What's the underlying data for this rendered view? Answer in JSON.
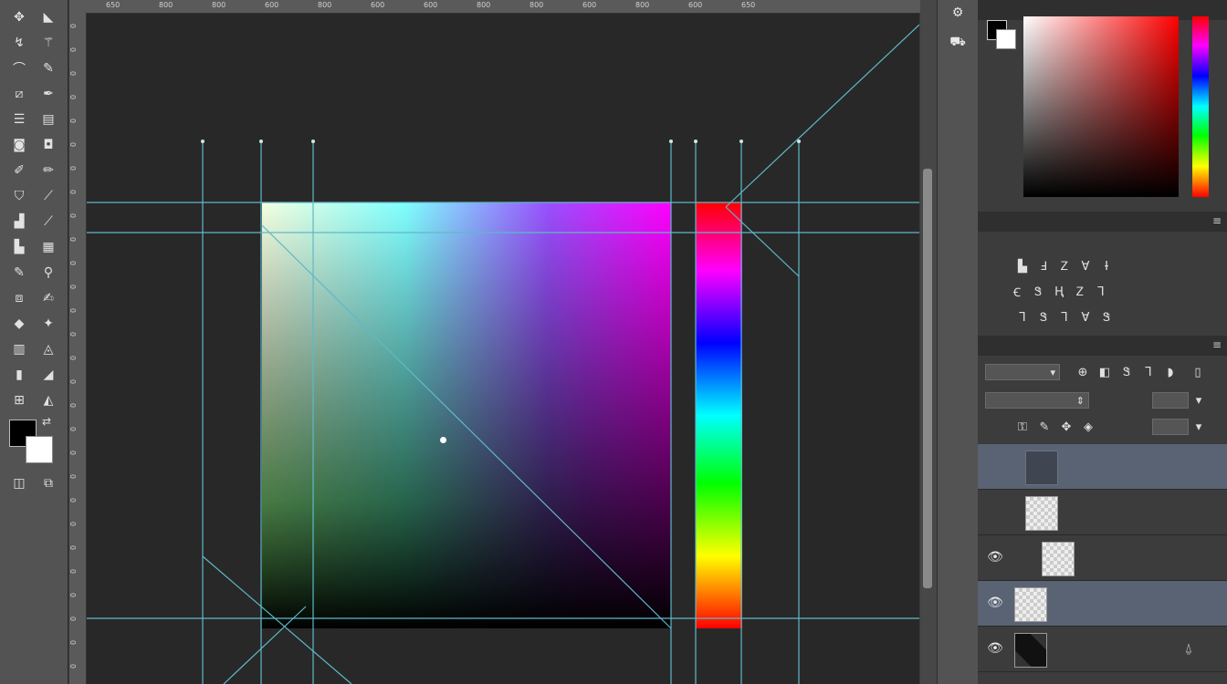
{
  "toolbar": {
    "tools": [
      {
        "icon": "move-icon",
        "glyph": "✥"
      },
      {
        "icon": "artboard-icon",
        "glyph": "◣"
      },
      {
        "icon": "lasso-icon",
        "glyph": "↯"
      },
      {
        "icon": "magic-wand-icon",
        "glyph": "⚚"
      },
      {
        "icon": "polygon-lasso-icon",
        "glyph": "⌒"
      },
      {
        "icon": "quick-select-icon",
        "glyph": "✎"
      },
      {
        "icon": "crop-icon",
        "glyph": "⧄"
      },
      {
        "icon": "eyedropper-icon",
        "glyph": "✒"
      },
      {
        "icon": "frame-icon",
        "glyph": "☰"
      },
      {
        "icon": "slice-icon",
        "glyph": "▤"
      },
      {
        "icon": "healing-brush-icon",
        "glyph": "◙"
      },
      {
        "icon": "patch-icon",
        "glyph": "◘"
      },
      {
        "icon": "brush-icon",
        "glyph": "✐"
      },
      {
        "icon": "pencil-icon",
        "glyph": "✏"
      },
      {
        "icon": "clone-stamp-icon",
        "glyph": "⛉"
      },
      {
        "icon": "history-brush-icon",
        "glyph": "⟋"
      },
      {
        "icon": "eraser-icon",
        "glyph": "▟"
      },
      {
        "icon": "bg-eraser-icon",
        "glyph": "⟋"
      },
      {
        "icon": "gradient-icon",
        "glyph": "▙"
      },
      {
        "icon": "paint-bucket-icon",
        "glyph": "▦"
      },
      {
        "icon": "blur-icon",
        "glyph": "✎"
      },
      {
        "icon": "sharpen-icon",
        "glyph": "⚲"
      },
      {
        "icon": "dodge-icon",
        "glyph": "⧈"
      },
      {
        "icon": "burn-icon",
        "glyph": "✍"
      },
      {
        "icon": "pen-icon",
        "glyph": "◆"
      },
      {
        "icon": "freeform-pen-icon",
        "glyph": "✦"
      },
      {
        "icon": "type-icon",
        "glyph": "▥"
      },
      {
        "icon": "vertical-type-icon",
        "glyph": "◬"
      },
      {
        "icon": "path-select-icon",
        "glyph": "▮"
      },
      {
        "icon": "direct-select-icon",
        "glyph": "◢"
      },
      {
        "icon": "shape-icon",
        "glyph": "⊞"
      },
      {
        "icon": "custom-shape-icon",
        "glyph": "◭"
      }
    ],
    "quickmask": [
      {
        "icon": "quick-mask-icon",
        "glyph": "◫"
      },
      {
        "icon": "screen-mode-icon",
        "glyph": "⧉"
      }
    ]
  },
  "rulers": {
    "top": [
      "650",
      "800",
      "800",
      "600",
      "800",
      "600",
      "600",
      "800",
      "800",
      "600",
      "800",
      "600",
      "650"
    ],
    "left": [
      "0",
      "0",
      "0",
      "0",
      "0",
      "0",
      "0",
      "0",
      "0",
      "0",
      "0",
      "0",
      "0",
      "0",
      "0",
      "0",
      "0",
      "0",
      "0",
      "0",
      "0",
      "0",
      "0",
      "0",
      "0",
      "0",
      "0",
      "0"
    ]
  },
  "dock": [
    {
      "icon": "history-panel-icon",
      "glyph": "⚙"
    },
    {
      "icon": "properties-panel-icon",
      "glyph": "⛟"
    }
  ],
  "color_panel": {
    "tabs": [
      "",
      "",
      "",
      ""
    ]
  },
  "adjustments": {
    "tabs": [
      "",
      "",
      "",
      ""
    ],
    "title": "",
    "rows": [
      [
        "▙",
        "Ⅎ",
        "Ꮓ",
        "Ɐ",
        "Ɨ"
      ],
      [
        "Ꞓ",
        "Ꮥ",
        "Ⱨ",
        "Ꮓ",
        "Ꞁ"
      ],
      [
        "Ꞁ",
        "Ꮥ",
        "Ꞁ",
        "Ɐ",
        "Ꮥ"
      ]
    ]
  },
  "layers_panel": {
    "tabs": [
      "",
      "",
      ""
    ],
    "kind_label": "",
    "blend_mode": "",
    "opacity_label": "",
    "opacity_value": "",
    "lock_label": "",
    "fill_label": "",
    "fill_value": "",
    "layers": [
      {
        "name": "",
        "visible": false,
        "selected": true
      },
      {
        "name": "",
        "visible": false,
        "selected": false
      },
      {
        "name": "",
        "visible": true,
        "selected": false
      },
      {
        "name": "",
        "visible": true,
        "selected": true
      },
      {
        "name": "",
        "visible": true,
        "selected": false
      }
    ]
  },
  "colors": {
    "accent_guide": "#5fb9c9",
    "selection": "#596374"
  }
}
